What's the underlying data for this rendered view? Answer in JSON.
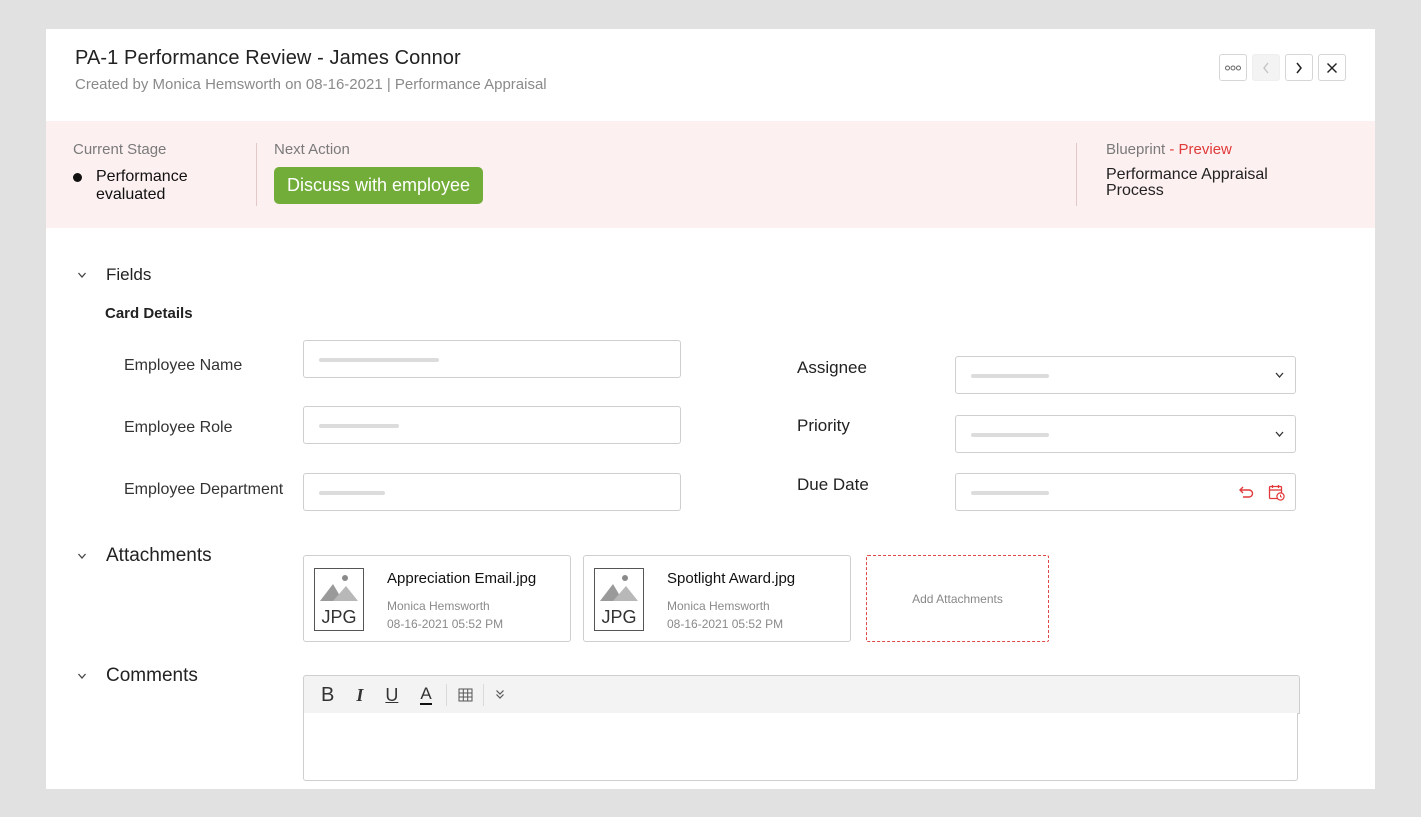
{
  "header": {
    "title": "PA-1 Performance Review - James Connor",
    "subtitle": "Created by Monica Hemsworth on 08-16-2021 | Performance Appraisal"
  },
  "header_buttons": [
    {
      "name": "more-options-button",
      "icon": "more-horizontal-icon",
      "enabled": true
    },
    {
      "name": "previous-button",
      "icon": "chevron-left-icon",
      "enabled": false
    },
    {
      "name": "next-button",
      "icon": "chevron-right-icon",
      "enabled": true
    },
    {
      "name": "close-button",
      "icon": "close-icon",
      "enabled": true
    }
  ],
  "stage": {
    "current_label": "Current Stage",
    "current_value": "Performance evaluated",
    "next_label": "Next Action",
    "action_button": "Discuss with employee",
    "blueprint_label": "Blueprint",
    "blueprint_preview": "- Preview",
    "blueprint_value": "Performance Appraisal Process",
    "action_color": "#72ad3a",
    "background_color": "#fdf0f0"
  },
  "sections": {
    "fields": "Fields",
    "card_details": "Card Details",
    "attachments": "Attachments",
    "comments": "Comments"
  },
  "fields": {
    "employee_name": "Employee Name",
    "employee_role": "Employee Role",
    "employee_department": "Employee Department",
    "assignee": "Assignee",
    "priority": "Priority",
    "due_date": "Due Date"
  },
  "attachments": [
    {
      "name": "Appreciation Email.jpg",
      "by": "Monica Hemsworth",
      "date": "08-16-2021 05:52 PM",
      "type": "JPG"
    },
    {
      "name": "Spotlight Award.jpg",
      "by": "Monica Hemsworth",
      "date": "08-16-2021 05:52 PM",
      "type": "JPG"
    }
  ],
  "add_attachments": "Add Attachments",
  "editor_toolbar": {
    "bold": "B",
    "italic": "I",
    "underline": "U",
    "font_color": "A"
  },
  "accent_red": "#e03a3a"
}
